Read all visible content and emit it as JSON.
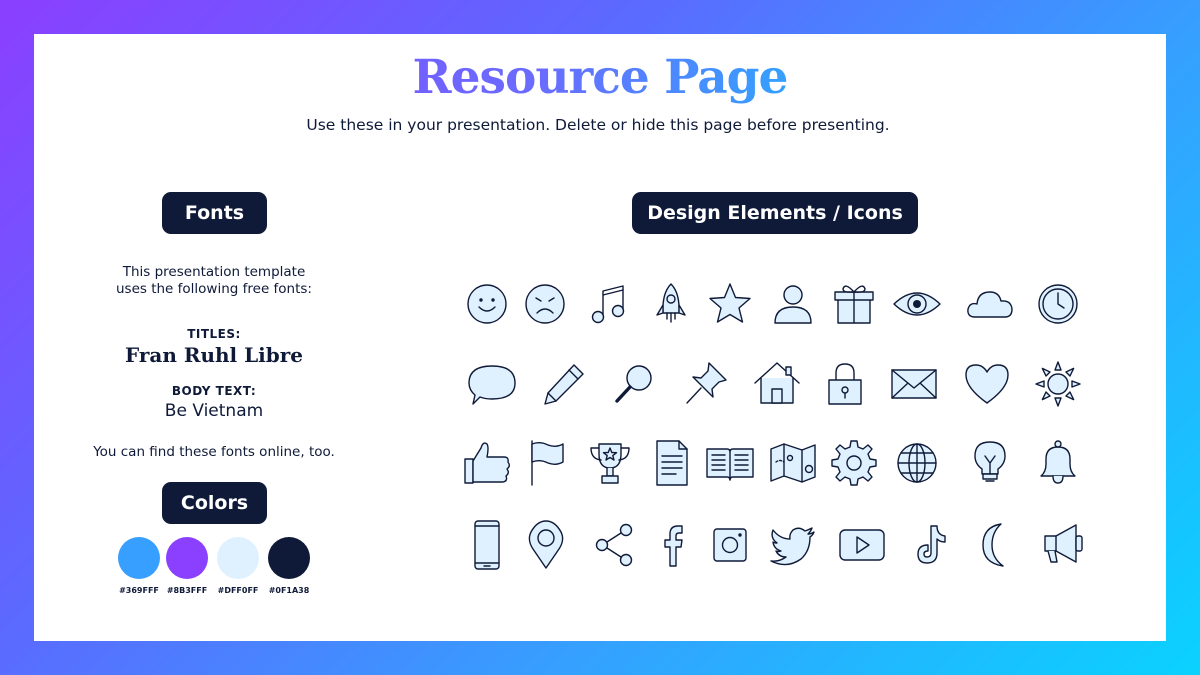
{
  "page": {
    "title": "Resource Page",
    "subtitle": "Use these in your presentation. Delete or hide this page before presenting."
  },
  "fonts_section": {
    "heading": "Fonts",
    "intro_line1": "This presentation template",
    "intro_line2": "uses the following free fonts:",
    "titles_label": "TITLES:",
    "titles_font": "Fran Ruhl Libre",
    "body_label": "BODY TEXT:",
    "body_font": "Be Vietnam",
    "footer": "You can find these fonts online, too."
  },
  "colors_section": {
    "heading": "Colors",
    "swatches": [
      {
        "hex": "#369FFF",
        "label": "#369FFF"
      },
      {
        "hex": "#8B3FFF",
        "label": "#8B3FFF"
      },
      {
        "hex": "#DFF0FF",
        "label": "#DFF0FF"
      },
      {
        "hex": "#0F1A38",
        "label": "#0F1A38"
      }
    ]
  },
  "design_section": {
    "heading": "Design Elements / Icons",
    "icon_rows": [
      [
        "smile-icon",
        "sad-icon",
        "music-note-icon",
        "rocket-icon",
        "star-icon",
        "user-icon",
        "gift-icon",
        "eye-icon",
        "cloud-icon",
        "clock-icon"
      ],
      [
        "speech-bubble-icon",
        "pencil-icon",
        "magnifier-icon",
        "pushpin-icon",
        "home-icon",
        "padlock-icon",
        "envelope-icon",
        "heart-icon",
        "sun-icon"
      ],
      [
        "thumbs-up-icon",
        "flag-icon",
        "trophy-icon",
        "document-icon",
        "open-book-icon",
        "map-icon",
        "gear-icon",
        "globe-icon",
        "lightbulb-icon",
        "bell-icon"
      ],
      [
        "smartphone-icon",
        "location-pin-icon",
        "share-icon",
        "facebook-icon",
        "instagram-icon",
        "twitter-icon",
        "youtube-icon",
        "tiktok-icon",
        "crescent-moon-icon",
        "megaphone-icon"
      ]
    ]
  },
  "colors": {
    "accent_blue": "#369FFF",
    "accent_purple": "#8B3FFF",
    "icon_fill": "#DFF0FF",
    "dark_navy": "#0F1A38"
  }
}
